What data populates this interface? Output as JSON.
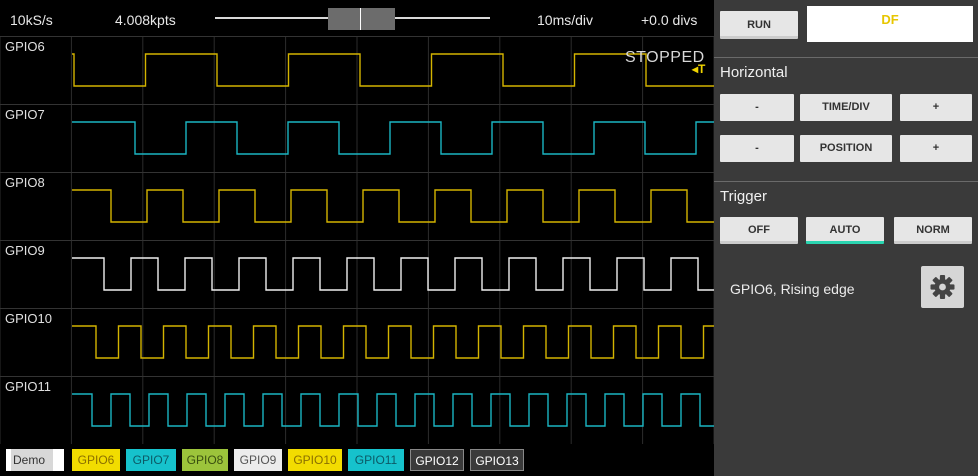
{
  "status_bar": {
    "sample_rate": "10kS/s",
    "points": "4.008kpts",
    "time_per_div": "10ms/div",
    "position": "+0.0 divs"
  },
  "scope": {
    "status": "STOPPED",
    "trigger_marker": "◂T",
    "channels": [
      {
        "label": "GPIO6",
        "color": "#d4b400",
        "period": 143,
        "phase": 2
      },
      {
        "label": "GPIO7",
        "color": "#1bb5c2",
        "period": 102,
        "phase": 63
      },
      {
        "label": "GPIO8",
        "color": "#d4b400",
        "period": 72,
        "phase": 39
      },
      {
        "label": "GPIO9",
        "color": "#f0f0f0",
        "period": 54,
        "phase": 32
      },
      {
        "label": "GPIO10",
        "color": "#d4b400",
        "period": 45,
        "phase": 24
      },
      {
        "label": "GPIO11",
        "color": "#1bb5c2",
        "period": 38,
        "phase": 20
      }
    ]
  },
  "bottom_bar": {
    "demo": "Demo",
    "chips": [
      {
        "label": "GPIO6",
        "bg": "#f2dc00",
        "fg": "#8a6f00"
      },
      {
        "label": "GPIO7",
        "bg": "#16c2cc",
        "fg": "#0c5a66"
      },
      {
        "label": "GPIO8",
        "bg": "#9cc43b",
        "fg": "#3a5010"
      },
      {
        "label": "GPIO9",
        "bg": "#ececec",
        "fg": "#555555"
      },
      {
        "label": "GPIO10",
        "bg": "#f2dc00",
        "fg": "#8a6f00"
      },
      {
        "label": "GPIO11",
        "bg": "#16c2cc",
        "fg": "#0c5a66"
      },
      {
        "label": "GPIO12",
        "bg": "#3a3a3a",
        "fg": "#ffffff"
      },
      {
        "label": "GPIO13",
        "bg": "#3a3a3a",
        "fg": "#ffffff"
      }
    ]
  },
  "panel": {
    "run_label": "RUN",
    "brand_label": "DF",
    "horizontal_title": "Horizontal",
    "minus_label": "-",
    "plus_label": "+",
    "timediv_label": "TIME/DIV",
    "position_label": "POSITION",
    "trigger_title": "Trigger",
    "trigger_modes": [
      "OFF",
      "AUTO",
      "NORM"
    ],
    "active_trigger_mode": "AUTO",
    "trigger_description": "GPIO6, Rising edge",
    "accent_color": "#2bd4b0"
  }
}
